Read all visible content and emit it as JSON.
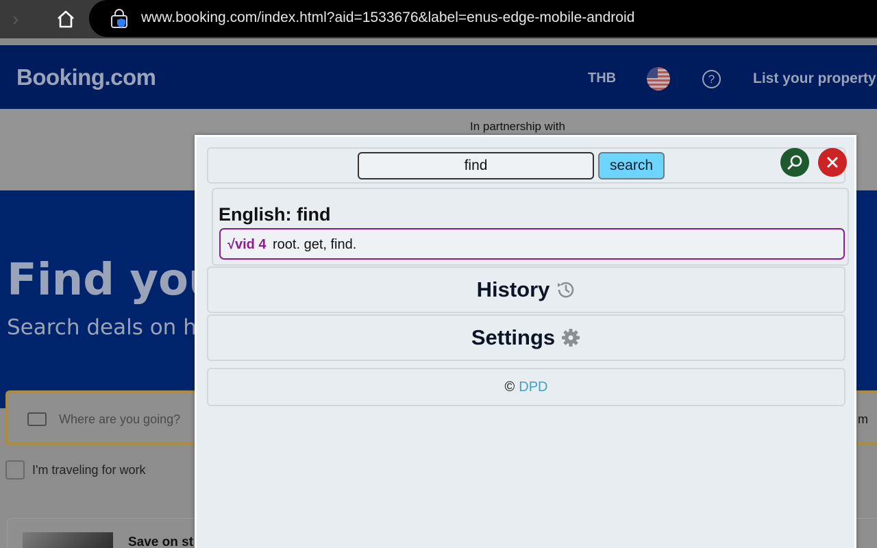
{
  "browser": {
    "url": "www.booking.com/index.html?aid=1533676&label=enus-edge-mobile-android",
    "icons": [
      "forward-arrow-icon",
      "home-icon",
      "lock-icon"
    ]
  },
  "booking": {
    "logo": "Booking.com",
    "currency": "THB",
    "help_icon": "?",
    "list_property": "List your property",
    "partnership": "In partnership with",
    "hero_title": "Find you",
    "hero_subtitle": "Search deals on h",
    "destination_placeholder": "Where are you going?",
    "search_trailing": "m",
    "work_checkbox_label": "I'm traveling for work",
    "card_title": "Save on st"
  },
  "popup": {
    "search_value": "find",
    "search_button": "search",
    "result_heading": "English: find",
    "entries": [
      {
        "root": "√vid 4",
        "text": "root. get, find."
      }
    ],
    "history_label": "History",
    "settings_label": "Settings",
    "credit_symbol": "©",
    "credit_link": "DPD",
    "colors": {
      "panel": "#e7edf0",
      "search_button": "#6dd5fb",
      "entry_accent": "#8d1d8e",
      "lens_button": "#1f5a2e",
      "close_button": "#cc2424",
      "link": "#3fa1c4"
    }
  }
}
